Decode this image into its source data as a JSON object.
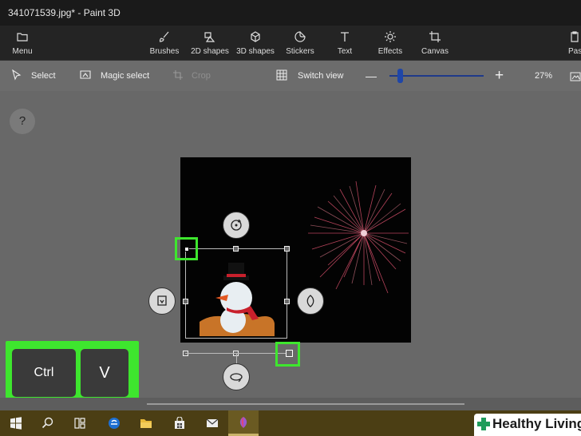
{
  "window": {
    "title": "341071539.jpg* - Paint 3D"
  },
  "ribbon": {
    "items": [
      {
        "label": "Menu",
        "icon": "folder-icon"
      },
      {
        "label": "Brushes",
        "icon": "brush-icon"
      },
      {
        "label": "2D shapes",
        "icon": "2d-shapes-icon"
      },
      {
        "label": "3D shapes",
        "icon": "cube-icon"
      },
      {
        "label": "Stickers",
        "icon": "sticker-icon"
      },
      {
        "label": "Text",
        "icon": "text-icon"
      },
      {
        "label": "Effects",
        "icon": "sun-icon"
      },
      {
        "label": "Canvas",
        "icon": "crop-frame-icon"
      },
      {
        "label": "Past",
        "icon": "paste-icon"
      }
    ]
  },
  "toolbar": {
    "select": "Select",
    "magic_select": "Magic select",
    "crop": "Crop",
    "switch_view": "Switch view",
    "zoom_out": "—",
    "zoom_in": "+",
    "zoom_level": "27%",
    "zoom_fraction": 0.1
  },
  "help": {
    "label": "?"
  },
  "keyboard_hint": {
    "key1": "Ctrl",
    "key2": "V"
  },
  "taskbar": {
    "icons": [
      "windows-start-icon",
      "search-icon",
      "task-view-icon",
      "edge-icon",
      "file-explorer-icon",
      "store-icon",
      "mail-icon",
      "paint-3d-icon"
    ]
  },
  "watermark": {
    "text": "Healthy Living"
  },
  "colors": {
    "highlight": "#3ee62e",
    "accent": "#1f46a8",
    "taskbar": "#4b3e14",
    "canvas": "#030303"
  }
}
